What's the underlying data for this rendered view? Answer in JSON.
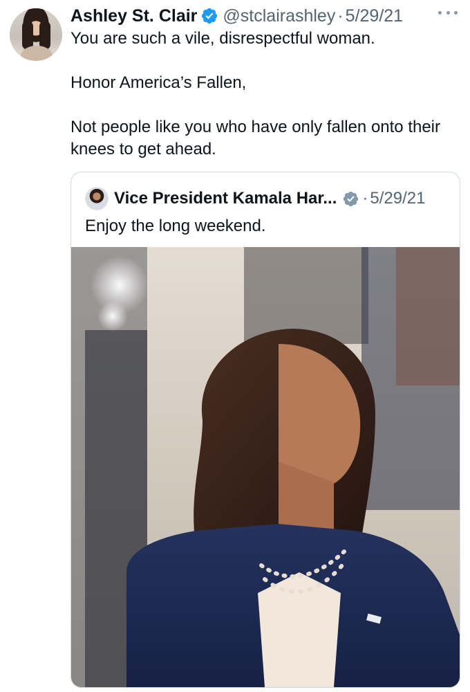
{
  "tweet": {
    "display_name": "Ashley St. Clair",
    "handle": "@stclairashley",
    "separator": "·",
    "date": "5/29/21",
    "more_icon": "more-horizontal-icon",
    "paragraphs": [
      "You are such a vile, disrespectful woman.",
      "Honor America’s Fallen,",
      "Not people like you who have only fallen onto their knees to get ahead."
    ]
  },
  "quoted_tweet": {
    "display_name": "Vice President Kamala Har...",
    "separator": "·",
    "date": "5/29/21",
    "text": "Enjoy the long weekend.",
    "badge_icon": "government-verified-icon",
    "media": "photo"
  },
  "colors": {
    "text_primary": "#0f1419",
    "text_secondary": "#536471",
    "verified_blue": "#1d9bf0",
    "government_grey": "#829aab",
    "border": "#cfd9de"
  }
}
